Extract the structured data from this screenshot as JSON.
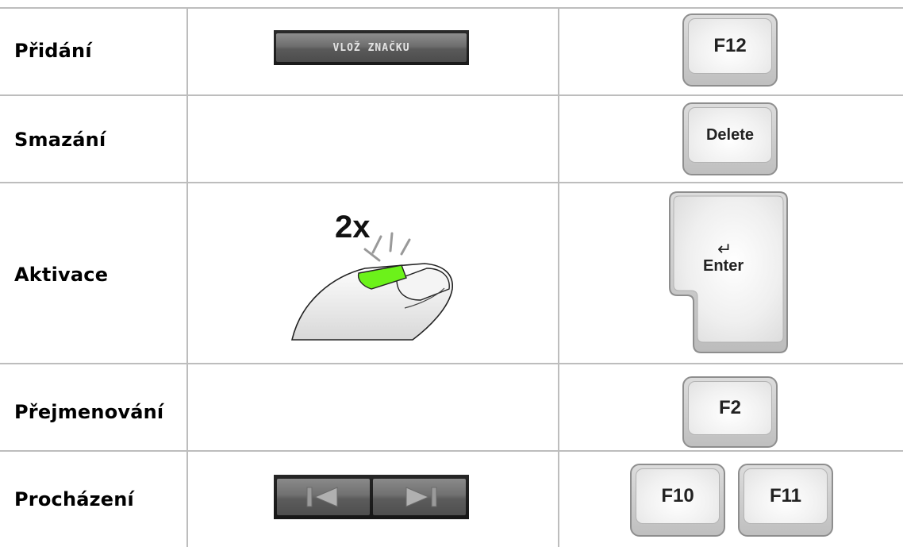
{
  "rows": [
    {
      "label": "Přidání",
      "ui_button": "VLOŽ ZNAČKU",
      "keys": [
        "F12"
      ]
    },
    {
      "label": "Smazání",
      "keys": [
        "Delete"
      ]
    },
    {
      "label": "Aktivace",
      "mouse_text": "2x",
      "enter_arrow": "↵",
      "keys": [
        "Enter"
      ]
    },
    {
      "label": "Přejmenování",
      "keys": [
        "F2"
      ]
    },
    {
      "label": "Procházení",
      "nav": [
        "previous-icon",
        "next-icon"
      ],
      "keys": [
        "F10",
        "F11"
      ]
    }
  ],
  "colors": {
    "grid": "#bdbdbd",
    "mouse_highlight": "#6cf21a"
  }
}
